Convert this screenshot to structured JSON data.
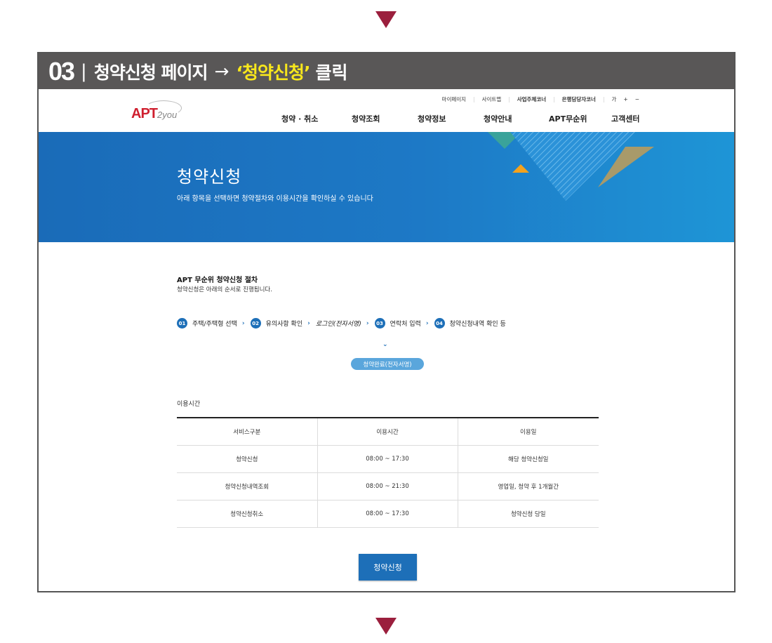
{
  "step_header": {
    "number": "03",
    "separator": "|",
    "text": "청약신청 페이지",
    "arrow": "→",
    "highlight": "‘청약신청’",
    "action": "클릭"
  },
  "site": {
    "logo_apt": "APT",
    "logo_2you": "2you",
    "util_nav": [
      "마이페이지",
      "사이트맵",
      "사업주체코너",
      "은행담당자코너",
      "가",
      "+",
      "−"
    ],
    "main_nav": [
      "청약 · 취소",
      "청약조회",
      "청약정보",
      "청약안내",
      "APT무순위",
      "고객센터"
    ]
  },
  "banner": {
    "title": "청약신청",
    "subtitle": "아래 항목을 선택하면 청약절차와 이용시간을 확인하실 수 있습니다",
    "colors": {
      "blue": "#1a6bb8",
      "teal": "#3aa39a",
      "gold": "#a89a6a",
      "orange": "#f4a21c"
    }
  },
  "procedure": {
    "title": "APT 무순위 청약신청 절차",
    "description": "청약신청은 아래의 순서로 진행됩니다.",
    "steps": [
      {
        "num": "01",
        "label": "주택/주택형 선택"
      },
      {
        "num": "02",
        "label": "유의사항 확인"
      },
      {
        "num": "",
        "label": "로그인(전자서명)"
      },
      {
        "num": "03",
        "label": "연락처 입력"
      },
      {
        "num": "04",
        "label": "청약신청내역 확인 등"
      }
    ],
    "chevron": "›",
    "down_chevron": "⌄",
    "complete": "청약완료(전자서명)"
  },
  "usage": {
    "title": "이용시간",
    "headers": [
      "서비스구분",
      "이용시간",
      "이용일"
    ],
    "rows": [
      [
        "청약신청",
        "08:00 ~ 17:30",
        "해당 청약신청일"
      ],
      [
        "청약신청내역조회",
        "08:00 ~ 21:30",
        "영업일, 청약 후 1개월간"
      ],
      [
        "청약신청취소",
        "08:00 ~ 17:30",
        "청약신청 당일"
      ]
    ]
  },
  "apply_button": "청약신청",
  "accent_color": "#1d6fb8",
  "arrow_color": "#9b1f3d"
}
